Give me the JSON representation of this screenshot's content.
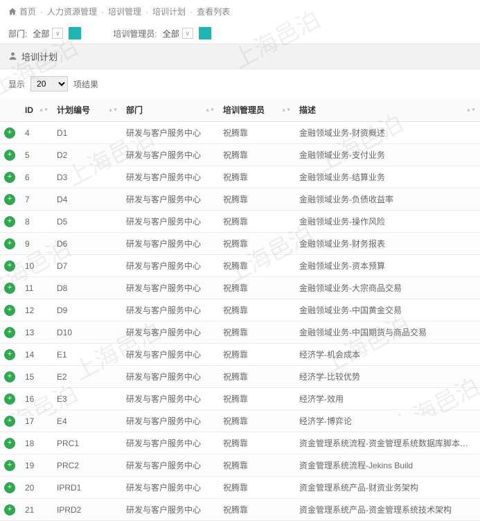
{
  "watermark_text": "上海邑泊",
  "breadcrumb": {
    "home": "首页",
    "items": [
      "人力资源管理",
      "培训管理",
      "培训计划",
      "查看列表"
    ]
  },
  "filters": {
    "dept_label": "部门:",
    "dept_value": "全部",
    "mgr_label": "培训管理员:",
    "mgr_value": "全部"
  },
  "panel_title": "培训计划",
  "show": {
    "prefix": "显示",
    "value": "20",
    "suffix": "项结果"
  },
  "columns": {
    "id": "ID",
    "plan": "计划编号",
    "dept": "部门",
    "mgr": "培训管理员",
    "desc": "描述"
  },
  "rows": [
    {
      "id": "4",
      "plan": "D1",
      "dept": "研发与客户服务中心",
      "mgr": "祝腾靠",
      "desc": "金融领域业务-财资概述"
    },
    {
      "id": "5",
      "plan": "D2",
      "dept": "研发与客户服务中心",
      "mgr": "祝腾靠",
      "desc": "金融领域业务-支付业务"
    },
    {
      "id": "6",
      "plan": "D3",
      "dept": "研发与客户服务中心",
      "mgr": "祝腾靠",
      "desc": "金融领域业务-结算业务"
    },
    {
      "id": "7",
      "plan": "D4",
      "dept": "研发与客户服务中心",
      "mgr": "祝腾靠",
      "desc": "金融领域业务-负债收益率"
    },
    {
      "id": "8",
      "plan": "D5",
      "dept": "研发与客户服务中心",
      "mgr": "祝腾靠",
      "desc": "金融领域业务-操作风险"
    },
    {
      "id": "9",
      "plan": "D6",
      "dept": "研发与客户服务中心",
      "mgr": "祝腾靠",
      "desc": "金融领域业务-财务报表"
    },
    {
      "id": "10",
      "plan": "D7",
      "dept": "研发与客户服务中心",
      "mgr": "祝腾靠",
      "desc": "金融领域业务-资本预算"
    },
    {
      "id": "11",
      "plan": "D8",
      "dept": "研发与客户服务中心",
      "mgr": "祝腾靠",
      "desc": "金融领域业务-大宗商品交易"
    },
    {
      "id": "12",
      "plan": "D9",
      "dept": "研发与客户服务中心",
      "mgr": "祝腾靠",
      "desc": "金融领域业务-中国黄金交易"
    },
    {
      "id": "13",
      "plan": "D10",
      "dept": "研发与客户服务中心",
      "mgr": "祝腾靠",
      "desc": "金融领域业务-中国期货与商品交易"
    },
    {
      "id": "14",
      "plan": "E1",
      "dept": "研发与客户服务中心",
      "mgr": "祝腾靠",
      "desc": "经济学-机会成本"
    },
    {
      "id": "15",
      "plan": "E2",
      "dept": "研发与客户服务中心",
      "mgr": "祝腾靠",
      "desc": "经济学-比较优势"
    },
    {
      "id": "16",
      "plan": "E3",
      "dept": "研发与客户服务中心",
      "mgr": "祝腾靠",
      "desc": "经济学-效用"
    },
    {
      "id": "17",
      "plan": "E4",
      "dept": "研发与客户服务中心",
      "mgr": "祝腾靠",
      "desc": "经济学-博弈论"
    },
    {
      "id": "18",
      "plan": "PRC1",
      "dept": "研发与客户服务中心",
      "mgr": "祝腾靠",
      "desc": "资金管理系统流程-资金管理系统数据库脚本修改流程"
    },
    {
      "id": "19",
      "plan": "PRC2",
      "dept": "研发与客户服务中心",
      "mgr": "祝腾靠",
      "desc": "资金管理系统流程-Jekins Build"
    },
    {
      "id": "20",
      "plan": "IPRD1",
      "dept": "研发与客户服务中心",
      "mgr": "祝腾靠",
      "desc": "资金管理系统产品-财资业务架构"
    },
    {
      "id": "21",
      "plan": "IPRD2",
      "dept": "研发与客户服务中心",
      "mgr": "祝腾靠",
      "desc": "资金管理系统产品-资金管理系统技术架构"
    }
  ]
}
